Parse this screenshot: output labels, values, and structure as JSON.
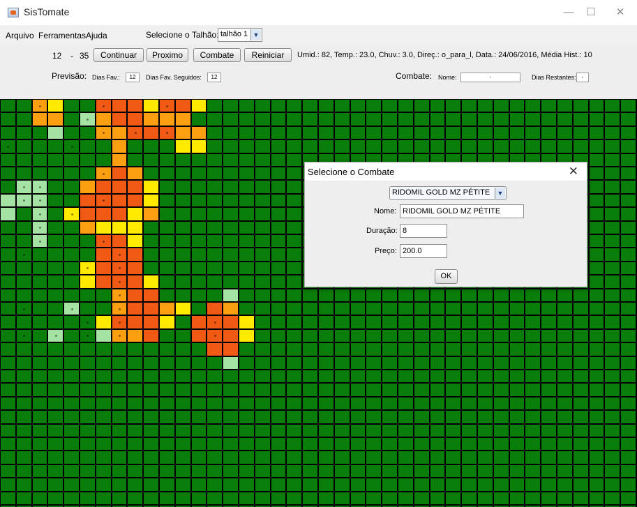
{
  "window": {
    "title": "SisTomate",
    "icon": "java-cup-icon",
    "controls": [
      "—",
      "☐",
      "✕"
    ]
  },
  "menu": {
    "items": [
      "Arquivo",
      "Ferramentas",
      "Ajuda"
    ],
    "talhao_label": "Selecione o Talhão:",
    "talhao_value": "talhão 1"
  },
  "toolbar": {
    "range_from": "12",
    "range_sep": "-",
    "range_to": "35",
    "buttons": [
      "Continuar",
      "Proximo",
      "Combate",
      "Reiniciar"
    ],
    "status": "Umid.: 82, Temp.: 23.0, Chuv.: 3.0, Direç.: o_para_l, Data.: 24/06/2016, Média Hist.: 10",
    "previsao_label": "Previsão:",
    "dias_fav_label": "Dias Fav.:",
    "dias_fav_value": "12",
    "dias_fav_seg_label": "Dias Fav. Seguidos:",
    "dias_fav_seg_value": "12",
    "combate_label": "Combate:",
    "nome_label": "Nome:",
    "nome_value": "-",
    "dias_rest_label": "Dias Restantes:",
    "dias_rest_value": "-"
  },
  "grid": {
    "colors": {
      "G": "#0a7e0a",
      "L": "#a4e3a4",
      "Y": "#ffea00",
      "O": "#fca012",
      "R": "#f05a14",
      "D": "#e6410f"
    },
    "legend_note": "",
    "rows": [
      "GGOYGGRRRYRRYGGG",
      "GGOOGLORROOOGGGG",
      "GGGLGGOORRROOGGG",
      "GGGGGGGOGGGYYGGG",
      "GGGGGGGOGGGGGGGG",
      "GGGGGGOROGGGGGGG",
      "GLLGGORRRYGGGGGG",
      "LLLGGRRRRYGGGGGG",
      "LGLGYRRRYOGGGGGG",
      "GGLGGOYYYGGGGGGG",
      "GGLGGGRRYGGGGGGG",
      "GGGGGGRRRGGGGGGG",
      "GGGGGYRRRGGGGGGG",
      "GGGGGYRRRYGGGGGG",
      "GGGGGGGORRGGGGLG",
      "GGGGLGGORROYGROG",
      "GGGGGGYRRRYGRRRY",
      "GGGLGGLOORGGRRRY",
      "GGGGGGGGGGGGGRRG",
      "GGGGGGGGGGGGGGLG"
    ],
    "dots": [
      [
        0,
        2
      ],
      [
        0,
        6
      ],
      [
        0,
        10
      ],
      [
        1,
        5
      ],
      [
        2,
        6
      ],
      [
        2,
        8
      ],
      [
        2,
        10
      ],
      [
        3,
        0
      ],
      [
        3,
        4
      ],
      [
        5,
        6
      ],
      [
        6,
        1
      ],
      [
        6,
        2
      ],
      [
        7,
        1
      ],
      [
        7,
        2
      ],
      [
        7,
        6
      ],
      [
        8,
        2
      ],
      [
        8,
        4
      ],
      [
        9,
        2
      ],
      [
        10,
        2
      ],
      [
        10,
        6
      ],
      [
        11,
        1
      ],
      [
        11,
        7
      ],
      [
        12,
        5
      ],
      [
        12,
        7
      ],
      [
        13,
        7
      ],
      [
        14,
        7
      ],
      [
        15,
        1
      ],
      [
        15,
        4
      ],
      [
        15,
        7
      ],
      [
        16,
        5
      ],
      [
        16,
        7
      ],
      [
        16,
        13
      ],
      [
        17,
        1
      ],
      [
        17,
        3
      ],
      [
        17,
        5
      ],
      [
        17,
        7
      ],
      [
        17,
        13
      ]
    ]
  },
  "dialog": {
    "title": "Selecione o Combate",
    "close": "✕",
    "combo_value": "RIDOMIL GOLD MZ PÉTITE",
    "nome_label": "Nome:",
    "nome_value": "RIDOMIL GOLD MZ PÉTITE",
    "duracao_label": "Duração:",
    "duracao_value": "8",
    "preco_label": "Preço:",
    "preco_value": "200.0",
    "ok_label": "OK"
  }
}
